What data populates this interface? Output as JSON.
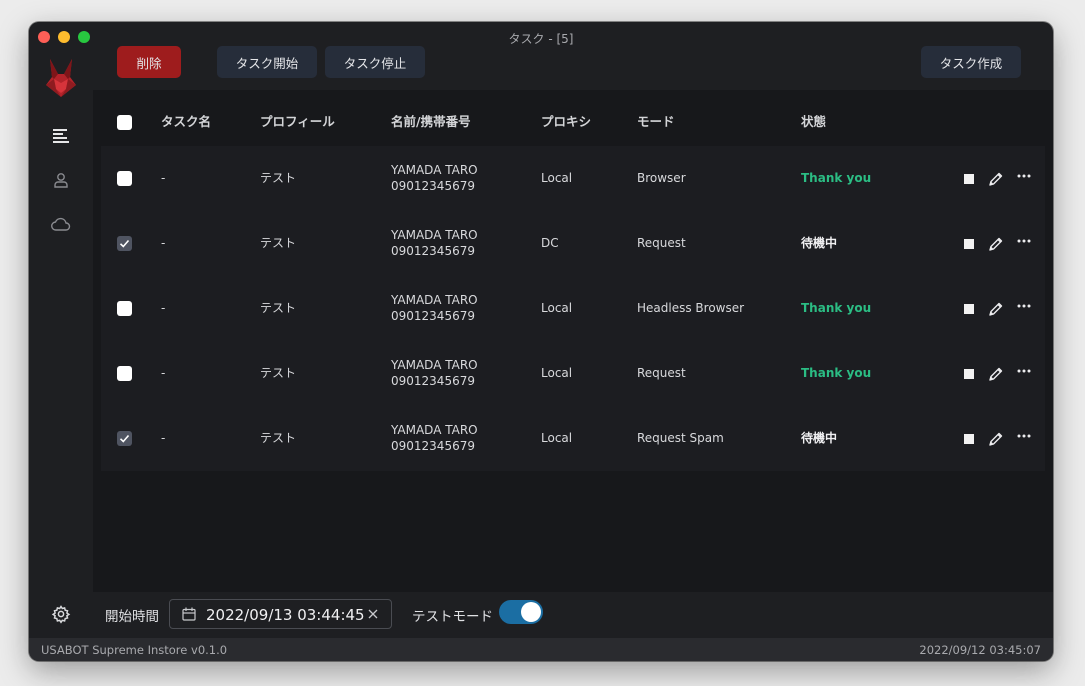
{
  "window": {
    "title": "タスク - [5]"
  },
  "toolbar": {
    "delete_label": "削除",
    "start_label": "タスク開始",
    "stop_label": "タスク停止",
    "create_label": "タスク作成"
  },
  "sidebar": {
    "items": [
      {
        "name": "tasks",
        "icon": "list-icon"
      },
      {
        "name": "profiles",
        "icon": "user-icon"
      },
      {
        "name": "proxies",
        "icon": "cloud-icon"
      }
    ]
  },
  "table": {
    "columns": [
      "タスク名",
      "プロフィール",
      "名前/携帯番号",
      "プロキシ",
      "モード",
      "状態"
    ],
    "rows": [
      {
        "checked": false,
        "task": "-",
        "profile": "テスト",
        "name": "YAMADA TARO",
        "phone": "09012345679",
        "proxy": "Local",
        "mode": "Browser",
        "status": "Thank you",
        "status_kind": "done"
      },
      {
        "checked": true,
        "task": "-",
        "profile": "テスト",
        "name": "YAMADA TARO",
        "phone": "09012345679",
        "proxy": "DC",
        "mode": "Request",
        "status": "待機中",
        "status_kind": "wait"
      },
      {
        "checked": false,
        "task": "-",
        "profile": "テスト",
        "name": "YAMADA TARO",
        "phone": "09012345679",
        "proxy": "Local",
        "mode": "Headless Browser",
        "status": "Thank you",
        "status_kind": "done"
      },
      {
        "checked": false,
        "task": "-",
        "profile": "テスト",
        "name": "YAMADA TARO",
        "phone": "09012345679",
        "proxy": "Local",
        "mode": "Request",
        "status": "Thank you",
        "status_kind": "done"
      },
      {
        "checked": true,
        "task": "-",
        "profile": "テスト",
        "name": "YAMADA TARO",
        "phone": "09012345679",
        "proxy": "Local",
        "mode": "Request Spam",
        "status": "待機中",
        "status_kind": "wait"
      }
    ]
  },
  "bottom": {
    "start_time_label": "開始時間",
    "start_time_value": "2022/09/13 03:44:45",
    "test_mode_label": "テストモード",
    "test_mode_on": true
  },
  "status_bar": {
    "version": "USABOT Supreme Instore v0.1.0",
    "clock": "2022/09/12 03:45:07"
  },
  "colors": {
    "delete": "#9e1c1d",
    "button": "#262d3a",
    "status_done": "#2bbd84",
    "toggle_on": "#1b6ea3"
  }
}
